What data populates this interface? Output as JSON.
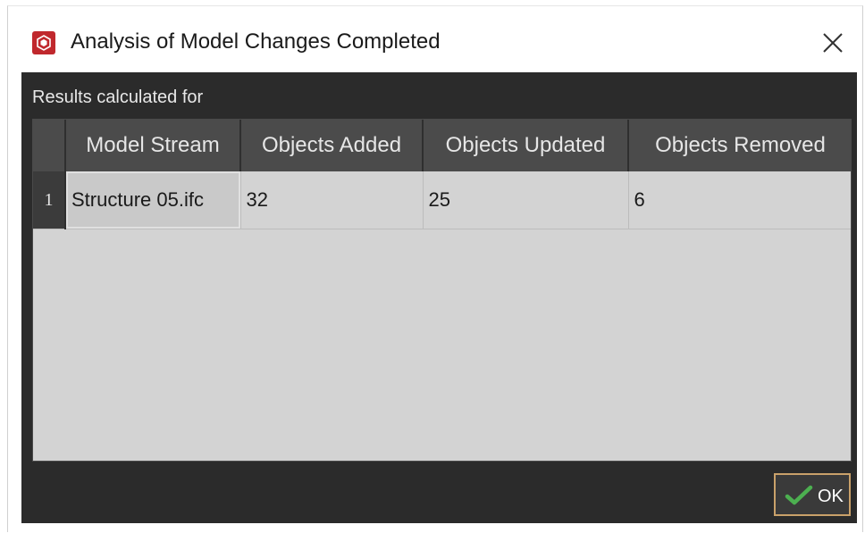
{
  "dialog": {
    "title": "Analysis of Model Changes Completed",
    "results_label": "Results calculated for",
    "ok_label": "OK"
  },
  "table": {
    "columns": [
      "Model Stream",
      "Objects Added",
      "Objects Updated",
      "Objects Removed"
    ],
    "rows": [
      {
        "index": "1",
        "model_stream": "Structure 05.ifc",
        "added": "32",
        "updated": "25",
        "removed": "6"
      }
    ]
  },
  "colors": {
    "app_icon": "#c0282d",
    "panel_bg": "#2b2b2b",
    "header_bg": "#4b4b4b",
    "grid_bg": "#d3d3d3",
    "ok_border": "#c9a16a",
    "ok_check": "#4caf50"
  },
  "icons": {
    "app": "app-logo-icon",
    "close": "close-icon",
    "ok": "checkmark-icon"
  }
}
